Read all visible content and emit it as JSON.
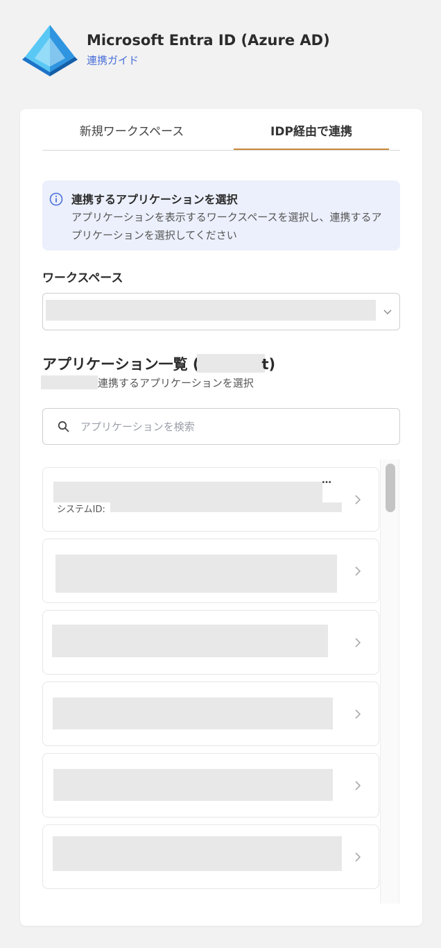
{
  "header": {
    "title": "Microsoft Entra ID (Azure AD)",
    "guide_link": "連携ガイド"
  },
  "tabs": [
    {
      "label": "新規ワークスペース",
      "active": false
    },
    {
      "label": "IDP経由で連携",
      "active": true
    }
  ],
  "info": {
    "title": "連携するアプリケーションを選択",
    "body": "アプリケーションを表示するワークスペースを選択し、連携するアプリケーションを選択してください"
  },
  "workspace": {
    "label": "ワークスペース"
  },
  "app_list": {
    "title_prefix": "アプリケーション一覧 (",
    "title_suffix": "t)",
    "subtitle": "連携するアプリケーションを選択",
    "search_placeholder": "アプリケーションを検索",
    "items": [
      {
        "ellipsis": "…",
        "system_id_label": "システムID:"
      },
      {},
      {},
      {},
      {},
      {}
    ]
  },
  "colors": {
    "accent_tab": "#c8883a",
    "link": "#4a6fd8",
    "info_bg": "#ecf0fc"
  }
}
